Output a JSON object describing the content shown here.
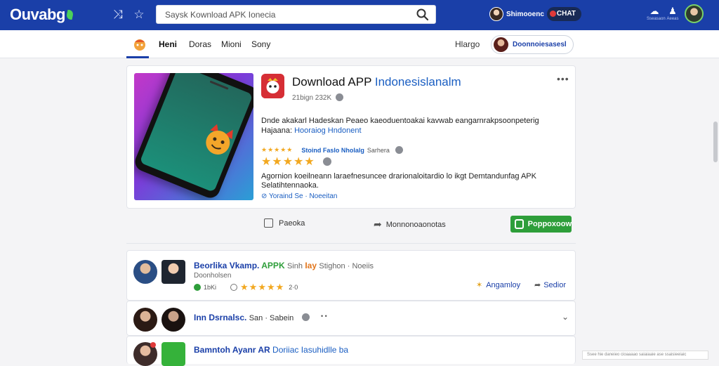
{
  "header": {
    "logo_text": "Ouvabg",
    "search": {
      "placeholder": "Saysk Kownload APK Ionecia",
      "value": ""
    },
    "user": {
      "name": "Shimooenc",
      "chat_label": "CHAT"
    },
    "right_icons": [
      {
        "label": "Sseasaon"
      },
      {
        "label": "Aeeas"
      }
    ]
  },
  "subnav": {
    "tabs": [
      {
        "label": "Heni",
        "active": true
      },
      {
        "label": "Doras",
        "active": false
      },
      {
        "label": "Mioni",
        "active": false
      },
      {
        "label": "Sony",
        "active": false
      }
    ],
    "lang_link": "Hlargo",
    "profile_name": "Doonnoiesasesl"
  },
  "feature": {
    "title_prefix": "Download APP",
    "title_highlight": "Indonesislanalm",
    "meta": "21bign 232K",
    "description": "Dnde akakarl Hadeskan Peaeo kaeoduentoakai kavwab eangarnrakpsoonpeterig",
    "description_link_prefix": "Hajaana:",
    "description_link": "Hooraiog Hndonent",
    "rating_small_source": "Stoind Faslo Nholalg",
    "rating_small_publisher": "Sarhera",
    "rating_stars": "★★★★★",
    "description2": "Agornion koeilneann laraefnesuncee drarionaloitardio lo ikgt Demtandunfag APK Selatihtennaoka.",
    "tag_link": "Yoraind Se · Noeeitan",
    "actions": {
      "secondary_label": "Paeoka",
      "share_label": "Monnonoaonotas",
      "primary_label": "Poppoxoow"
    }
  },
  "list": [
    {
      "title": "Beorlika Vkamp.",
      "title_green": "APPK",
      "title_rest": "Sinh",
      "title_orange": "Iay",
      "title_grey": "Stighon · Noeiis",
      "subtitle": "Doonholsen",
      "meta_count": "1bKi",
      "meta_rating": "2·0",
      "action1": "Angamloy",
      "action2": "Sedior"
    },
    {
      "title": "Inn Dsrnalsc.",
      "title_grey": "San · Sabein",
      "meta_extra": "• •"
    },
    {
      "title": "Bamntoh Ayanr AR",
      "title_orange": "Doriiac Iasuhidlle ba"
    }
  ],
  "toast": {
    "text": "Ssee hie daneieo cioaaaao saiaiaaie ase ssaisieeiaic"
  },
  "colors": {
    "primary_blue": "#1a3fa8",
    "accent_green": "#2e9e3a",
    "star": "#f2a820",
    "link": "#1a5ec2"
  }
}
